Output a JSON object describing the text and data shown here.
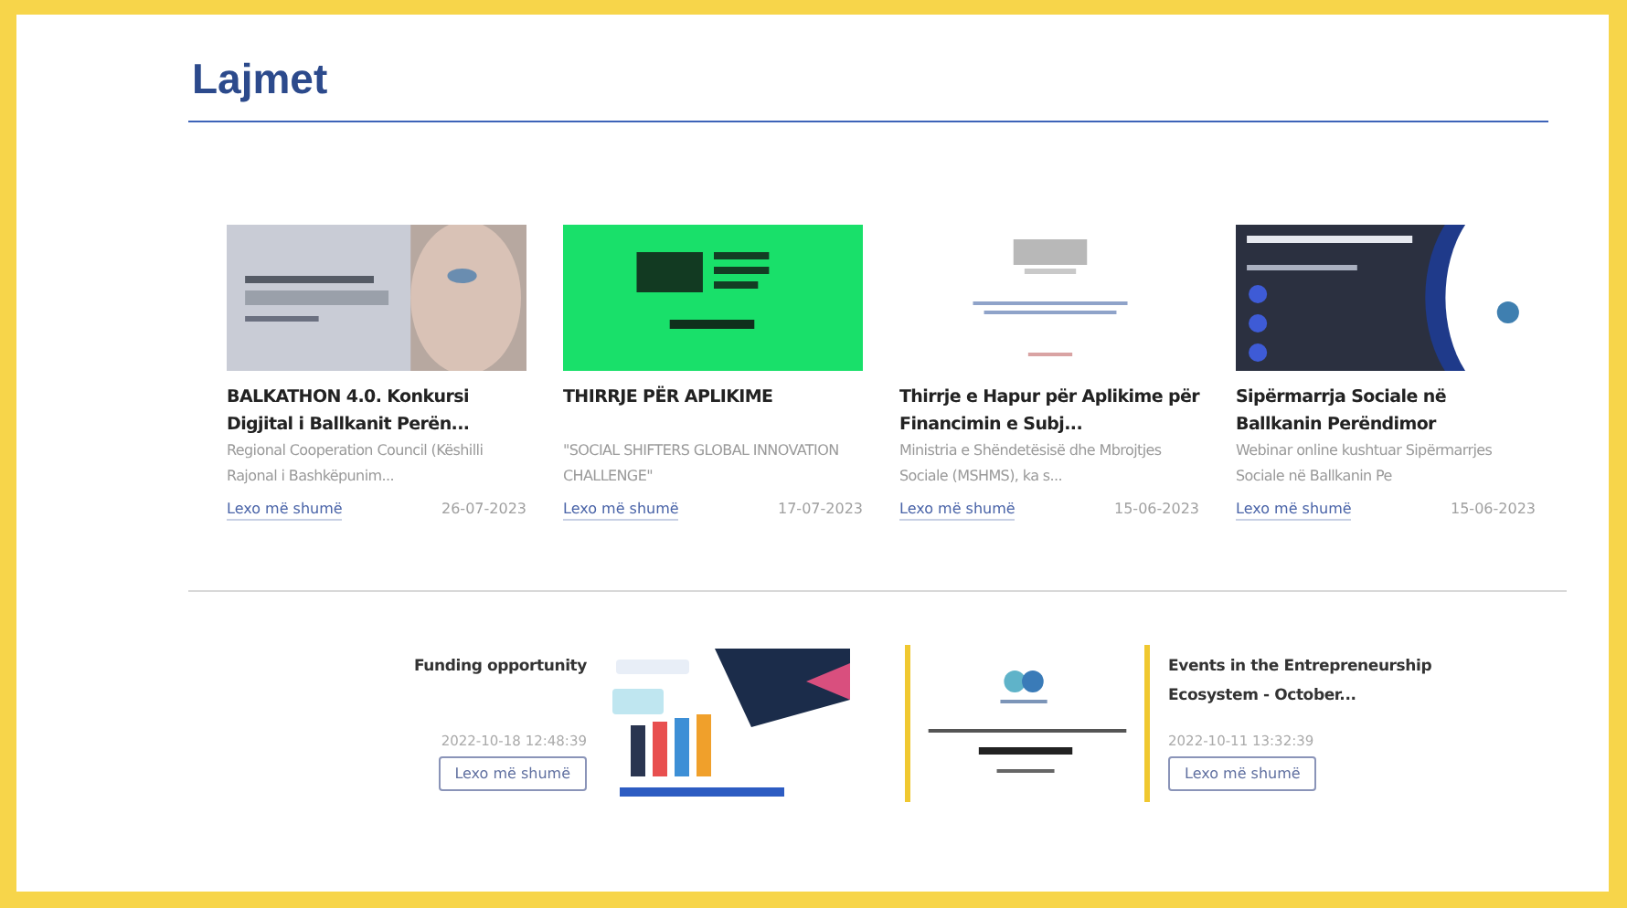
{
  "section_title": "Lajmet",
  "news": [
    {
      "title": "BALKATHON 4.0. Konkursi Digjital i Ballkanit Perën...",
      "excerpt": "Regional Cooperation Council (Këshilli Rajonal i Bashkëpunim...",
      "link": "Lexo më shumë",
      "date": "26-07-2023"
    },
    {
      "title": "THIRRJE PËR APLIKIME",
      "excerpt": "\"SOCIAL SHIFTERS GLOBAL INNOVATION CHALLENGE\"",
      "link": "Lexo më shumë",
      "date": "17-07-2023"
    },
    {
      "title": "Thirrje e Hapur për Aplikime për Financimin e Subj...",
      "excerpt": "Ministria e Shëndetësisë dhe Mbrojtjes Sociale (MSHMS), ka s...",
      "link": "Lexo më shumë",
      "date": "15-06-2023"
    },
    {
      "title": "Sipërmarrja Sociale në Ballkanin Perëndimor",
      "excerpt": "Webinar online kushtuar Sipërmarrjes Sociale në Ballkanin Pe",
      "link": "Lexo më shumë",
      "date": "15-06-2023"
    }
  ],
  "featured": [
    {
      "title": "Funding opportunity",
      "date": "2022-10-18 12:48:39",
      "button": "Lexo më shumë"
    },
    {
      "title": "Events in the Entrepreneurship Ecosystem - October...",
      "date": "2022-10-11 13:32:39",
      "button": "Lexo më shumë"
    }
  ]
}
